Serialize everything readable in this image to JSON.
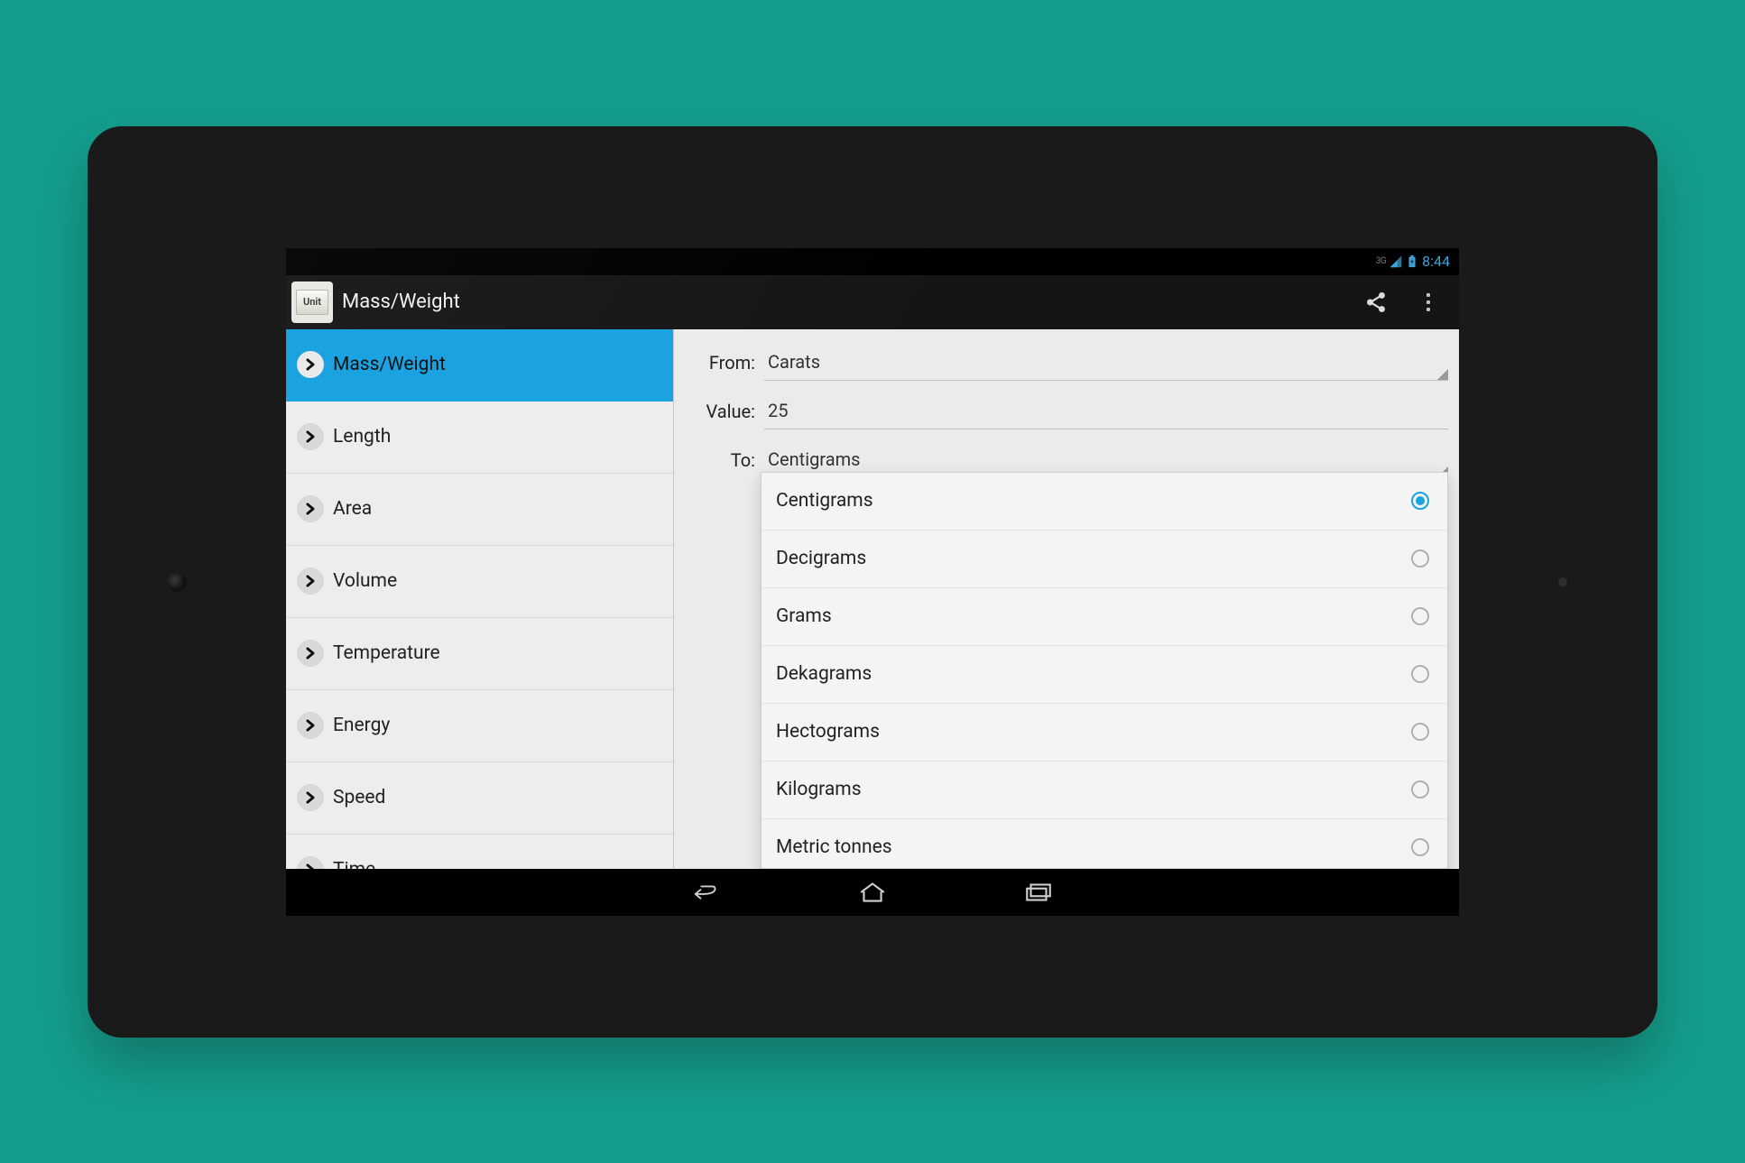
{
  "status": {
    "net": "3G",
    "time": "8:44"
  },
  "actionbar": {
    "app_icon_text": "Unit",
    "title": "Mass/Weight"
  },
  "sidebar": {
    "items": [
      {
        "label": "Mass/Weight",
        "selected": true
      },
      {
        "label": "Length",
        "selected": false
      },
      {
        "label": "Area",
        "selected": false
      },
      {
        "label": "Volume",
        "selected": false
      },
      {
        "label": "Temperature",
        "selected": false
      },
      {
        "label": "Energy",
        "selected": false
      },
      {
        "label": "Speed",
        "selected": false
      },
      {
        "label": "Time",
        "selected": false
      }
    ]
  },
  "form": {
    "from_label": "From:",
    "from_value": "Carats",
    "value_label": "Value:",
    "value_value": "25",
    "to_label": "To:",
    "to_value": "Centigrams"
  },
  "dropdown": {
    "options": [
      {
        "label": "Centigrams",
        "selected": true
      },
      {
        "label": "Decigrams",
        "selected": false
      },
      {
        "label": "Grams",
        "selected": false
      },
      {
        "label": "Dekagrams",
        "selected": false
      },
      {
        "label": "Hectograms",
        "selected": false
      },
      {
        "label": "Kilograms",
        "selected": false
      },
      {
        "label": "Metric tonnes",
        "selected": false
      }
    ]
  }
}
